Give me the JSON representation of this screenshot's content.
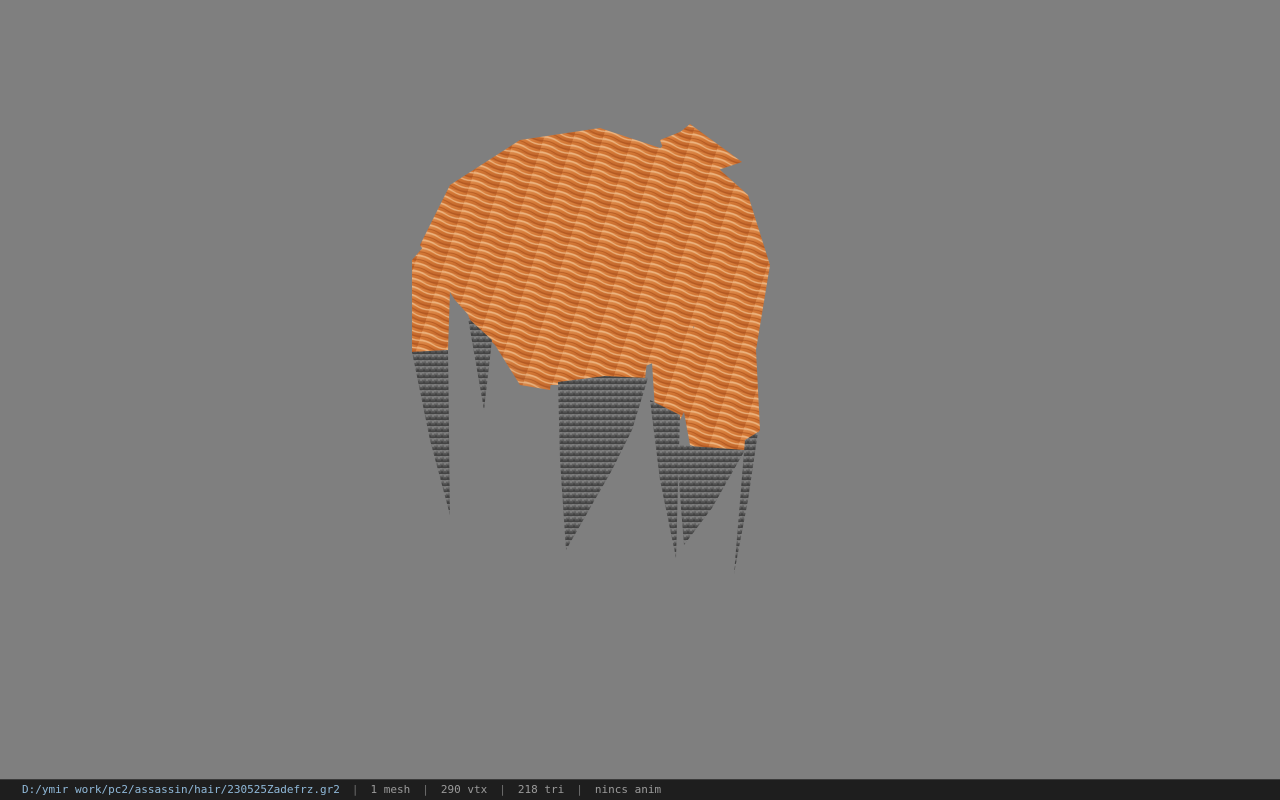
{
  "viewport": {
    "background_color": "#7f7f7f",
    "model": "hair mesh (orange strands with grey tips)",
    "colors": {
      "hair_base": "#d67a3a",
      "hair_light": "#e9a46e",
      "hair_dark": "#b45a24",
      "tip_grey": "#6c6c6c",
      "tip_dark": "#4a4a4a"
    }
  },
  "statusbar": {
    "file_path": "D:/ymir work/pc2/assassin/hair/230525Zadefrz.gr2",
    "separator": "|",
    "mesh_count": "1 mesh",
    "vertex_count": "290 vtx",
    "triangle_count": "218 tri",
    "anim_status": "nincs anim"
  }
}
